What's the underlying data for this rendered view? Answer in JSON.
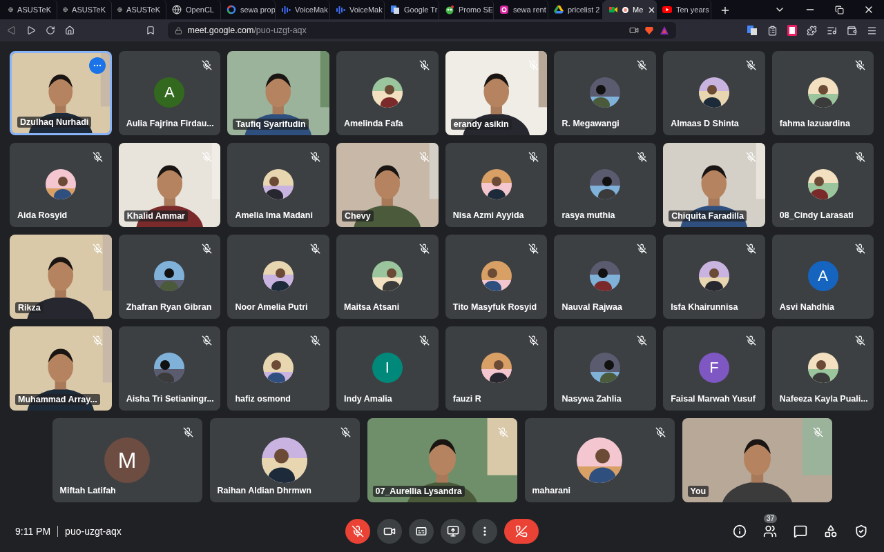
{
  "browser": {
    "tabs": [
      {
        "label": "ASUSTeK",
        "kind": "globe",
        "selected": false
      },
      {
        "label": "ASUSTeK",
        "kind": "globe",
        "selected": false
      },
      {
        "label": "ASUSTeK",
        "kind": "globe",
        "selected": false
      },
      {
        "label": "OpenCL",
        "kind": "globe",
        "selected": false
      },
      {
        "label": "sewa prop",
        "kind": "ring",
        "selected": false
      },
      {
        "label": "VoiceMak",
        "kind": "bars",
        "selected": false
      },
      {
        "label": "VoiceMak",
        "kind": "bars",
        "selected": false
      },
      {
        "label": "Google Tr",
        "kind": "translate",
        "selected": false
      },
      {
        "label": "Promo SE",
        "kind": "owl",
        "selected": false
      },
      {
        "label": "sewa rent",
        "kind": "camera",
        "selected": false
      },
      {
        "label": "pricelist 2",
        "kind": "triangle",
        "selected": false
      },
      {
        "label": "Me",
        "kind": "meet",
        "selected": true,
        "recording": true
      },
      {
        "label": "Ten years",
        "kind": "play",
        "selected": false
      }
    ],
    "url_host": "meet.google.com",
    "url_path": "/puo-uzgt-aqx"
  },
  "grid": [
    {
      "name": "Dzulhaq Nurhadi",
      "kind": "video",
      "muted": false,
      "highlighted": true
    },
    {
      "name": "Aulia Fajrina Firdau...",
      "kind": "letter",
      "letter": "A",
      "color": "#33691e",
      "muted": true,
      "highlighted": false
    },
    {
      "name": "Taufiq Syarifudin",
      "kind": "video",
      "muted": false,
      "highlighted": false
    },
    {
      "name": "Amelinda Fafa",
      "muted": true,
      "highlighted": false
    },
    {
      "name": "erandy asikin",
      "kind": "video",
      "muted": true,
      "highlighted": false
    },
    {
      "name": "R. Megawangi",
      "muted": true,
      "highlighted": false
    },
    {
      "name": "Almaas D Shinta",
      "muted": true,
      "highlighted": false
    },
    {
      "name": "fahma lazuardina",
      "muted": true,
      "highlighted": false
    },
    {
      "name": "Aida Rosyid",
      "muted": true,
      "highlighted": false
    },
    {
      "name": "Khalid Ammar",
      "kind": "video",
      "muted": true,
      "highlighted": false
    },
    {
      "name": "Amelia Ima Madani",
      "muted": true,
      "highlighted": false
    },
    {
      "name": "Chevy",
      "kind": "video",
      "muted": true,
      "highlighted": false
    },
    {
      "name": "Nisa Azmi Ayyida",
      "muted": true,
      "highlighted": false
    },
    {
      "name": "rasya muthia",
      "muted": true,
      "highlighted": false
    },
    {
      "name": "Chiquita Faradilla",
      "kind": "video",
      "muted": true,
      "highlighted": false
    },
    {
      "name": "08_Cindy Larasati",
      "muted": true,
      "highlighted": false
    },
    {
      "name": "Rikza",
      "kind": "video",
      "muted": true,
      "highlighted": false
    },
    {
      "name": "Zhafran Ryan Gibran",
      "muted": true,
      "highlighted": false
    },
    {
      "name": "Noor Amelia Putri",
      "muted": true,
      "highlighted": false
    },
    {
      "name": "Maitsa Atsani",
      "muted": true,
      "highlighted": false
    },
    {
      "name": "Tito Masyfuk Rosyid",
      "muted": true,
      "highlighted": false
    },
    {
      "name": "Nauval Rajwaa",
      "muted": true,
      "highlighted": false
    },
    {
      "name": "Isfa Khairunnisa",
      "muted": true,
      "highlighted": false
    },
    {
      "name": "Asvi Nahdhia",
      "kind": "letter",
      "letter": "A",
      "color": "#1565c0",
      "muted": true,
      "highlighted": false
    },
    {
      "name": "Muhammad Array...",
      "kind": "video",
      "muted": true,
      "highlighted": false
    },
    {
      "name": "Aisha Tri Setianingr...",
      "muted": true,
      "highlighted": false
    },
    {
      "name": "hafiz osmond",
      "muted": true,
      "highlighted": false
    },
    {
      "name": "Indy Amalia",
      "kind": "letter",
      "letter": "I",
      "color": "#00897b",
      "muted": true,
      "highlighted": false
    },
    {
      "name": "fauzi R",
      "muted": true,
      "highlighted": false
    },
    {
      "name": "Nasywa Zahlia",
      "muted": true,
      "highlighted": false
    },
    {
      "name": "Faisal Marwah Yusuf",
      "kind": "letter",
      "letter": "F",
      "color": "#7e57c2",
      "muted": true,
      "highlighted": false
    },
    {
      "name": "Nafeeza Kayla Puali...",
      "muted": true,
      "highlighted": false
    }
  ],
  "last_row": [
    {
      "name": "Miftah Latifah",
      "kind": "letter",
      "letter": "M",
      "color": "#6d4c41",
      "muted": true,
      "highlighted": false
    },
    {
      "name": "Raihan Aldian Dhrmwn",
      "muted": true,
      "highlighted": false
    },
    {
      "name": "07_Aurellia Lysandra",
      "kind": "video",
      "muted": true,
      "highlighted": false
    },
    {
      "name": "maharani",
      "muted": true,
      "highlighted": false
    },
    {
      "name": "You",
      "kind": "video",
      "muted": true,
      "highlighted": false
    }
  ],
  "bottom_bar": {
    "time": "9:11 PM",
    "meeting_code": "puo-uzgt-aqx",
    "mic_on": false,
    "participant_count": "37"
  }
}
